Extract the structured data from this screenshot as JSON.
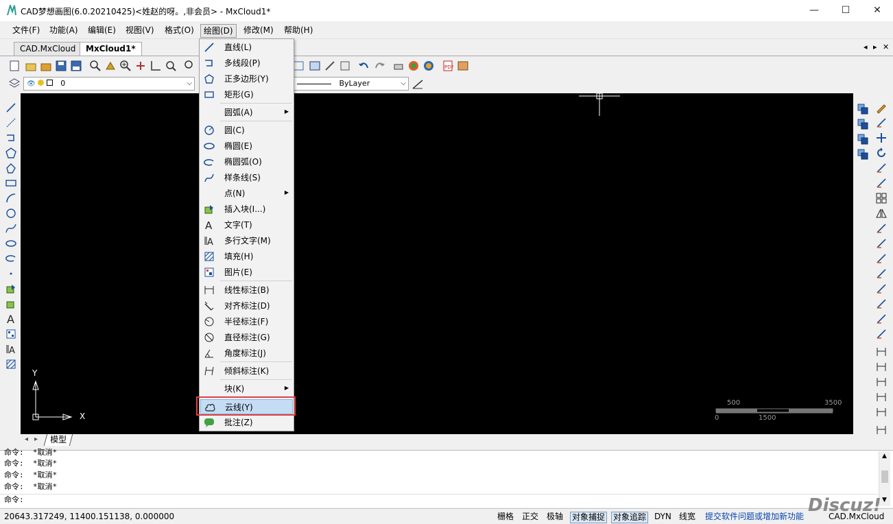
{
  "window": {
    "title": "CAD梦想画图(6.0.20210425)<姓赵的呀。,非会员> - MxCloud1*",
    "minimize": "—",
    "maximize": "☐",
    "close": "✕"
  },
  "menubar": {
    "items": [
      "文件(F)",
      "功能(A)",
      "编辑(E)",
      "视图(V)",
      "格式(O)",
      "绘图(D)",
      "修改(M)",
      "帮助(H)"
    ],
    "open_index": 5
  },
  "tabs": {
    "items": [
      "CAD.MxCloud",
      "MxCloud1*"
    ],
    "active": 1,
    "nav_left": "◂",
    "nav_right": "▸",
    "close": "✕"
  },
  "toolbar2": {
    "layer_value": "0",
    "linetype_value": "ByLayer"
  },
  "draw_menu": {
    "items": [
      {
        "label": "直线(L)",
        "icon": "line-icon"
      },
      {
        "label": "多线段(P)",
        "icon": "polyline-icon"
      },
      {
        "label": "正多边形(Y)",
        "icon": "polygon-icon"
      },
      {
        "label": "矩形(G)",
        "icon": "rectangle-icon"
      },
      {
        "label": "圆弧(A)",
        "icon": "",
        "submenu": true
      },
      {
        "label": "圆(C)",
        "icon": "circle-icon"
      },
      {
        "label": "椭圆(E)",
        "icon": "ellipse-icon"
      },
      {
        "label": "椭圆弧(O)",
        "icon": "ellipse-arc-icon"
      },
      {
        "label": "样条线(S)",
        "icon": "spline-icon"
      },
      {
        "label": "点(N)",
        "icon": "",
        "submenu": true
      },
      {
        "label": "插入块(I...)",
        "icon": "insert-block-icon"
      },
      {
        "label": "文字(T)",
        "icon": "text-icon"
      },
      {
        "label": "多行文字(M)",
        "icon": "mtext-icon"
      },
      {
        "label": "填充(H)",
        "icon": "hatch-icon"
      },
      {
        "label": "图片(E)",
        "icon": "image-icon"
      },
      {
        "label": "线性标注(B)",
        "icon": "linear-dim-icon"
      },
      {
        "label": "对齐标注(D)",
        "icon": "aligned-dim-icon"
      },
      {
        "label": "半径标注(F)",
        "icon": "radius-dim-icon"
      },
      {
        "label": "直径标注(G)",
        "icon": "diameter-dim-icon"
      },
      {
        "label": "角度标注(J)",
        "icon": "angle-dim-icon"
      },
      {
        "label": "倾斜标注(K)",
        "icon": "oblique-dim-icon"
      },
      {
        "label": "块(K)",
        "icon": "",
        "submenu": true
      },
      {
        "label": "云线(Y)",
        "icon": "revcloud-icon",
        "highlighted": true
      },
      {
        "label": "批注(Z)",
        "icon": "comment-icon"
      }
    ]
  },
  "canvas": {
    "background": "#000000",
    "ucs_x": "X",
    "ucs_y": "Y",
    "scale_labels": [
      "500",
      "3500",
      "0",
      "1500"
    ]
  },
  "model_tab": "模型",
  "command": {
    "lines": [
      "命令:  *取消*",
      "命令:  *取消*",
      "命令:  *取消*",
      "命令:  *取消*"
    ],
    "prompt": "命令:"
  },
  "status": {
    "coords": "20643.317249,  11400.151138,  0.000000",
    "toggles": [
      {
        "label": "栅格",
        "on": false
      },
      {
        "label": "正交",
        "on": false
      },
      {
        "label": "极轴",
        "on": false
      },
      {
        "label": "对象捕捉",
        "on": true
      },
      {
        "label": "对象追踪",
        "on": true
      },
      {
        "label": "DYN",
        "on": false
      },
      {
        "label": "线宽",
        "on": false
      }
    ],
    "feedback_link": "提交软件问题或增加新功能",
    "brand": "CAD.MxCloud"
  },
  "watermark": "Discuz!",
  "colors": {
    "accent": "#1b4f9c",
    "highlight_box": "#e04040",
    "link": "#0645ad"
  }
}
